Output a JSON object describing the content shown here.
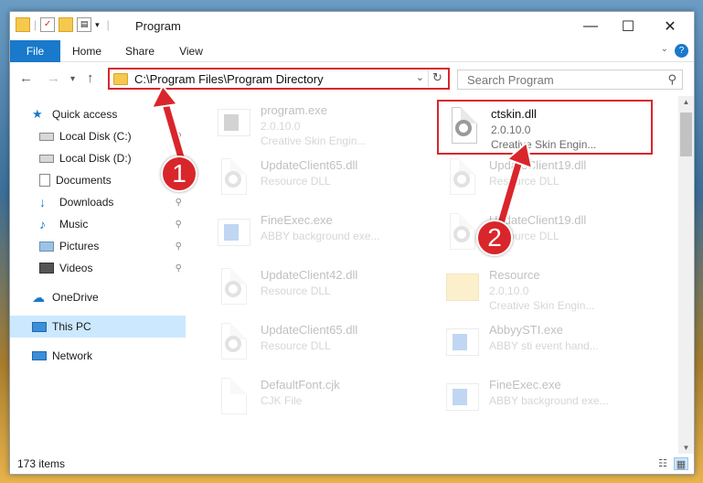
{
  "window": {
    "title": "Program"
  },
  "ribbon": {
    "tabs": [
      "File",
      "Home",
      "Share",
      "View"
    ]
  },
  "address": {
    "path": "C:\\Program Files\\Program Directory"
  },
  "search": {
    "placeholder": "Search Program"
  },
  "sidebar": {
    "items": [
      {
        "label": "Quick access",
        "icon": "star-icon"
      },
      {
        "label": "Local Disk (C:)",
        "icon": "drive-icon"
      },
      {
        "label": "Local Disk (D:)",
        "icon": "drive-icon"
      },
      {
        "label": "Documents",
        "icon": "documents-icon"
      },
      {
        "label": "Downloads",
        "icon": "download-icon"
      },
      {
        "label": "Music",
        "icon": "music-icon"
      },
      {
        "label": "Pictures",
        "icon": "pictures-icon"
      },
      {
        "label": "Videos",
        "icon": "videos-icon"
      },
      {
        "label": "OneDrive",
        "icon": "cloud-icon"
      },
      {
        "label": "This PC",
        "icon": "computer-icon"
      },
      {
        "label": "Network",
        "icon": "network-icon"
      }
    ]
  },
  "files": [
    {
      "name": "program.exe",
      "ver": "2.0.10.0",
      "desc": "Creative Skin Engin..."
    },
    {
      "name": "ctskin.dll",
      "ver": "2.0.10.0",
      "desc": "Creative Skin Engin..."
    },
    {
      "name": "UpdateClient65.dll",
      "ver": "Resource DLL",
      "desc": ""
    },
    {
      "name": "UpdateClient19.dll",
      "ver": "Resource DLL",
      "desc": ""
    },
    {
      "name": "FineExec.exe",
      "ver": "ABBY background exe...",
      "desc": ""
    },
    {
      "name": "UpdateClient19.dll",
      "ver": "Resource DLL",
      "desc": ""
    },
    {
      "name": "UpdateClient42.dll",
      "ver": "Resource DLL",
      "desc": ""
    },
    {
      "name": "Resource",
      "ver": "2.0.10.0",
      "desc": "Creative Skin Engin..."
    },
    {
      "name": "UpdateClient65.dll",
      "ver": "Resource DLL",
      "desc": ""
    },
    {
      "name": "AbbyySTI.exe",
      "ver": "ABBY sti event hand...",
      "desc": ""
    },
    {
      "name": "DefaultFont.cjk",
      "ver": "CJK File",
      "desc": ""
    },
    {
      "name": "FineExec.exe",
      "ver": "ABBY background exe...",
      "desc": ""
    }
  ],
  "status": {
    "count": "173 items"
  },
  "annotations": {
    "step1": "1",
    "step2": "2"
  },
  "colors": {
    "accent": "#1979ca",
    "highlight": "#d9262b",
    "selection": "#cce8ff"
  }
}
